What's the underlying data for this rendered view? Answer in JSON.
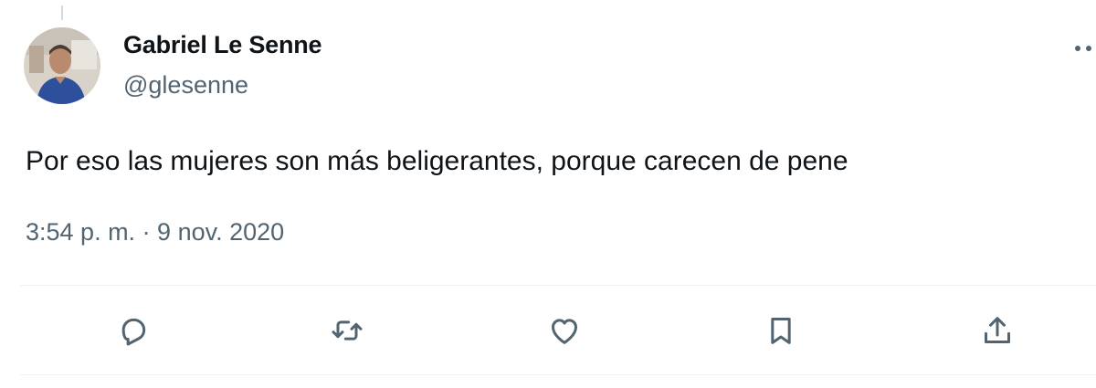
{
  "tweet": {
    "author": {
      "display_name": "Gabriel Le Senne",
      "handle": "@glesenne",
      "avatar_icon": "profile-photo"
    },
    "text": "Por eso las mujeres son más beligerantes, porque carecen de pene",
    "timestamp": "3:54 p. m. · 9 nov. 2020"
  },
  "actions": [
    {
      "name": "reply",
      "icon": "reply-icon"
    },
    {
      "name": "retweet",
      "icon": "retweet-icon"
    },
    {
      "name": "like",
      "icon": "heart-icon"
    },
    {
      "name": "bookmark",
      "icon": "bookmark-icon"
    },
    {
      "name": "share",
      "icon": "share-icon"
    }
  ],
  "colors": {
    "text_primary": "#0f1419",
    "text_secondary": "#536471",
    "divider": "#eff3f4"
  }
}
